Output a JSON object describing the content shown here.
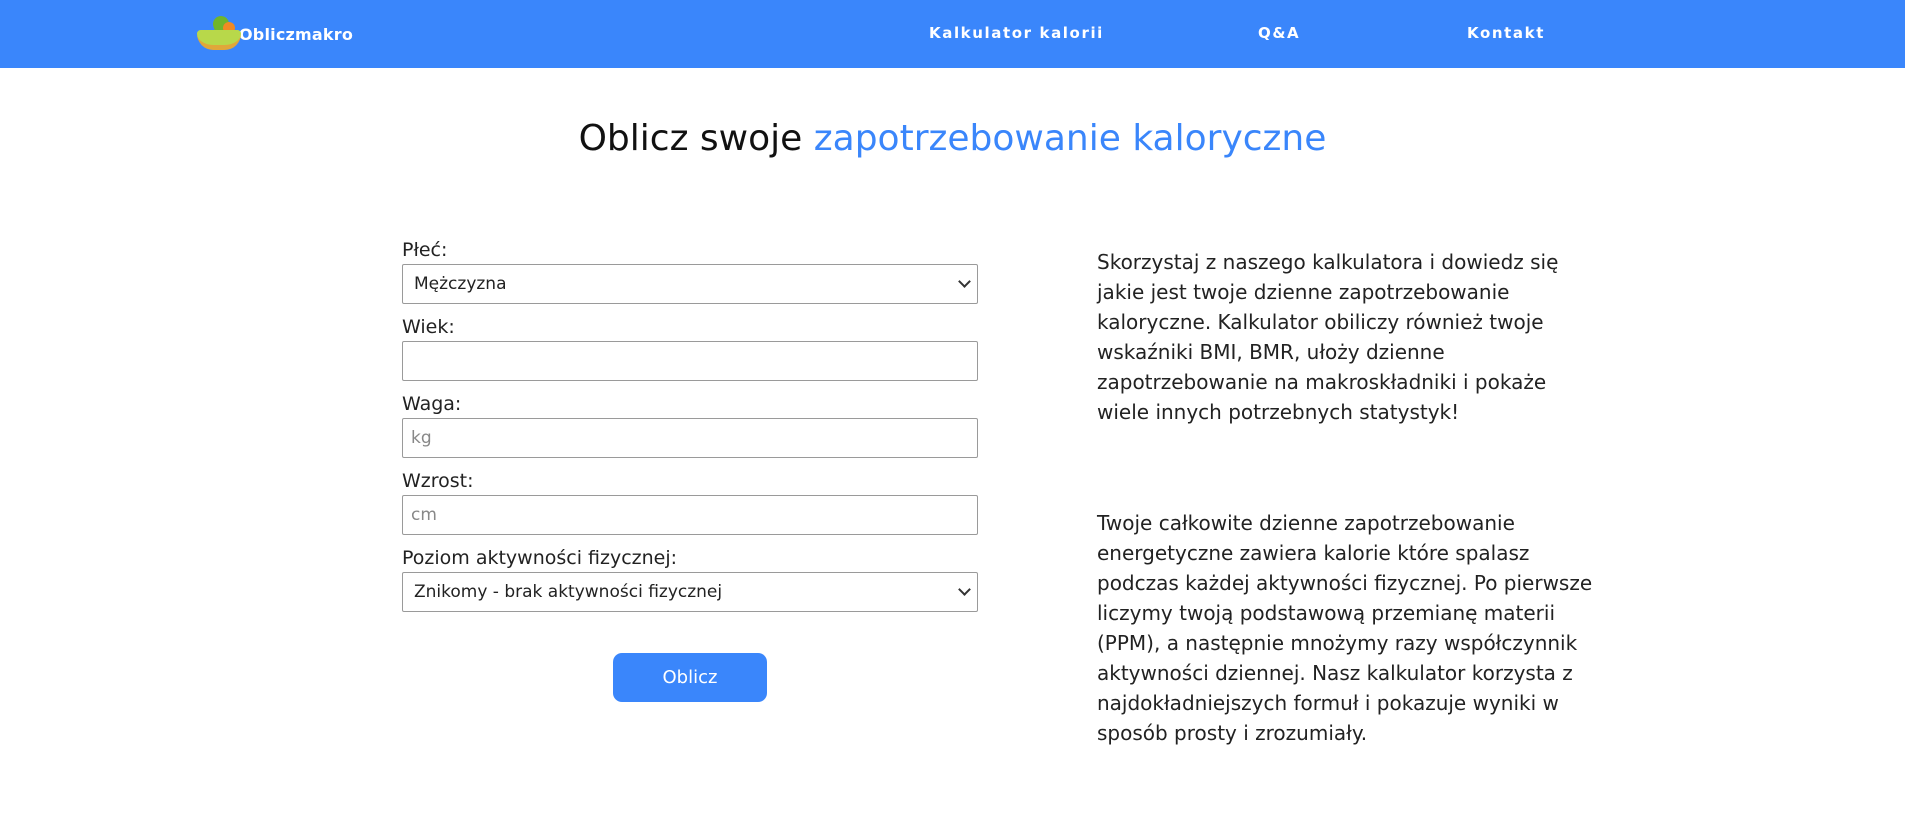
{
  "nav": {
    "brand": "Obliczmakro",
    "links": [
      "Kalkulator kalorii",
      "Q&A",
      "Kontakt"
    ]
  },
  "title": {
    "plain": "Oblicz swoje",
    "accent": "zapotrzebowanie kaloryczne"
  },
  "form": {
    "gender_label": "Płeć:",
    "gender_value": "Mężczyzna",
    "age_label": "Wiek:",
    "age_value": "",
    "weight_label": "Waga:",
    "weight_placeholder": "kg",
    "height_label": "Wzrost:",
    "height_placeholder": "cm",
    "activity_label": "Poziom aktywności fizycznej:",
    "activity_value": "Znikomy - brak aktywności fizycznej",
    "submit_label": "Oblicz"
  },
  "content": {
    "para1": "Skorzystaj z naszego kalkulatora i dowiedz się jakie jest twoje dzienne zapotrzebowanie kaloryczne. Kalkulator obiliczy również twoje wskaźniki BMI, BMR, ułoży dzienne zapotrzebowanie na makroskładniki i pokaże wiele innych potrzebnych statystyk!",
    "para2": "Twoje całkowite dzienne zapotrzebowanie energetyczne zawiera kalorie które spalasz podczas każdej aktywności fizycznej. Po pierwsze liczymy twoją podstawową przemianę materii (PPM), a następnie mnożymy razy współczynnik aktywności dziennej. Nasz kalkulator korzysta z najdokładniejszych formuł i pokazuje wyniki w sposób prosty i zrozumiały."
  },
  "colors": {
    "primary": "#3a86fb",
    "text": "#222222"
  },
  "icons": {
    "logo": "fruit-bowl-icon",
    "select": "chevron-down-icon"
  }
}
